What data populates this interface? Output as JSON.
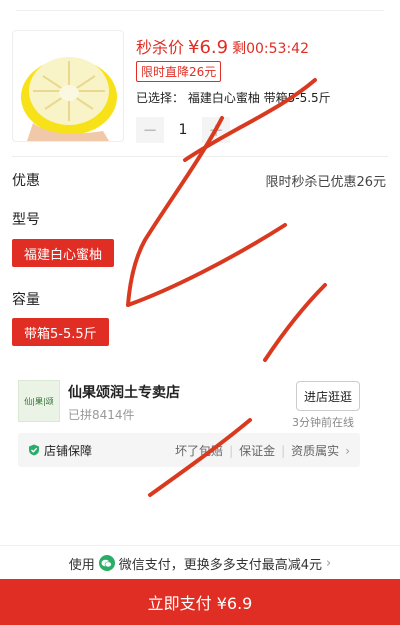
{
  "product": {
    "flash_label": "秒杀价",
    "price": "¥6.9",
    "countdown": "剩00:53:42",
    "discount_badge": "限时直降26元",
    "selected_text": "已选择：  福建白心蜜柚  带箱5-5.5斤",
    "quantity": "1",
    "minus": "−",
    "plus": "+"
  },
  "promo": {
    "label": "优惠",
    "value": "限时秒杀已优惠26元"
  },
  "spec": {
    "model_label": "型号",
    "model_option": "福建白心蜜柚",
    "capacity_label": "容量",
    "capacity_option": "带箱5-5.5斤"
  },
  "shop": {
    "logo_text": "仙|果|颂",
    "name": "仙果颂润土专卖店",
    "sold": "已拼8414件",
    "visit_label": "进店逛逛",
    "online": "3分钟前在线",
    "guarantee_title": "店铺保障",
    "guarantee_items": [
      "坏了包赔",
      "保证金",
      "资质属实"
    ]
  },
  "payment": {
    "prefix": "使用",
    "text": "微信支付，更换多多支付最高减4元",
    "chevron": "›"
  },
  "buy_button": "立即支付 ¥6.9",
  "colors": {
    "accent": "#e02e24",
    "wechat": "#2aae67"
  }
}
